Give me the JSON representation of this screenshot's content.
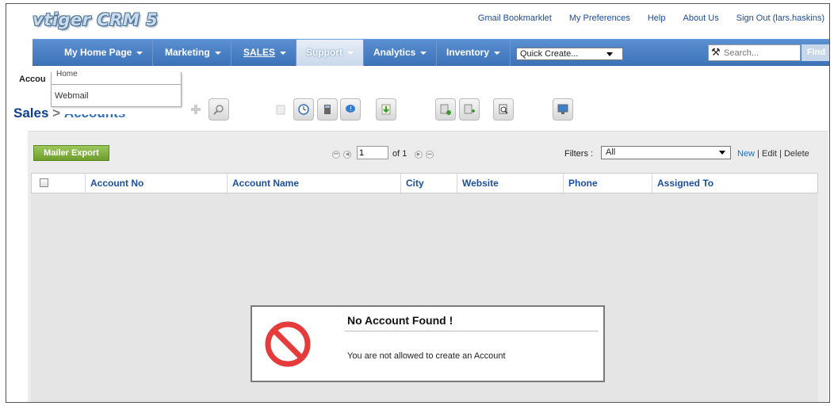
{
  "app": {
    "logo_text": "vtiger CRM 5"
  },
  "top_links": [
    "Gmail Bookmarklet",
    "My Preferences",
    "Help",
    "About Us",
    "Sign Out (lars.haskins)"
  ],
  "nav": {
    "tabs": [
      {
        "label": "My Home Page"
      },
      {
        "label": "Marketing"
      },
      {
        "label": "SALES"
      },
      {
        "label": "Support"
      },
      {
        "label": "Analytics"
      },
      {
        "label": "Inventory"
      }
    ],
    "active_tab": "SALES",
    "quick_create": "Quick Create...",
    "search_placeholder": "Search...",
    "find_label": "Find"
  },
  "dropdown": {
    "items": [
      "Home",
      "Webmail"
    ]
  },
  "breadcrumb_small": "Accou",
  "module": {
    "title": "Sales",
    "separator": " > ",
    "sub": "Accounts"
  },
  "toolbar_icons": [
    "add-icon",
    "search-icon",
    "calendar-icon",
    "clock-icon",
    "calculator-icon",
    "chat-icon",
    "import-icon",
    "export-icon",
    "export-all-icon",
    "find-duplicates-icon",
    "monitor-icon"
  ],
  "list": {
    "mailer_export": "Mailer Export",
    "page_value": "1",
    "page_of": "of 1",
    "filters_label": "Filters :",
    "filter_value": "All",
    "filter_links": {
      "new": "New",
      "sep": " | ",
      "edit": "Edit",
      "delete": "Delete"
    },
    "columns": [
      "Account No",
      "Account Name",
      "City",
      "Website",
      "Phone",
      "Assigned To"
    ]
  },
  "empty_dialog": {
    "title": "No Account Found !",
    "message": "You are not allowed to create an Account",
    "icon": "prohibited-icon"
  }
}
